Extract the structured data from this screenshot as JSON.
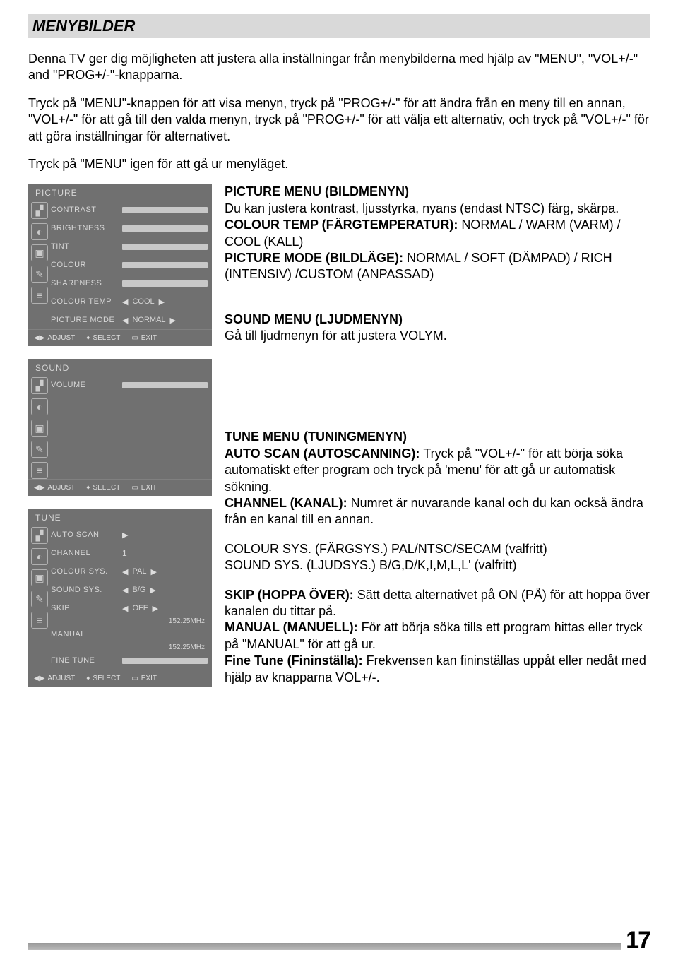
{
  "header": "MENYBILDER",
  "intro": "Denna TV ger dig möjligheten att justera alla inställningar från menybilderna med hjälp av \"MENU\", \"VOL+/-\" and \"PROG+/-\"-knapparna.",
  "para1": "Tryck på \"MENU\"-knappen för att visa menyn, tryck på \"PROG+/-\" för att ändra från en meny till en annan, \"VOL+/-\" för att gå till den valda menyn, tryck på \"PROG+/-\" för att välja ett alternativ, och tryck på \"VOL+/-\" för att göra inställningar för alternativet.",
  "para2": "Tryck på \"MENU\" igen för att gå ur menyläget.",
  "panels": {
    "picture": {
      "title": "PICTURE",
      "rows": {
        "contrast": "CONTRAST",
        "brightness": "BRIGHTNESS",
        "tint": "TINT",
        "colour": "COLOUR",
        "sharpness": "SHARPNESS",
        "colourtemp": "COLOUR TEMP",
        "colourtemp_val": "COOL",
        "picmode": "PICTURE MODE",
        "picmode_val": "NORMAL"
      }
    },
    "sound": {
      "title": "SOUND",
      "rows": {
        "volume": "VOLUME"
      }
    },
    "tune": {
      "title": "TUNE",
      "rows": {
        "autoscan": "AUTO SCAN",
        "channel": "CHANNEL",
        "channel_val": "1",
        "coloursys": "COLOUR SYS.",
        "coloursys_val": "PAL",
        "soundsys": "SOUND SYS.",
        "soundsys_val": "B/G",
        "skip": "SKIP",
        "skip_val": "OFF",
        "manual": "MANUAL",
        "finetune": "FINE TUNE",
        "freq": "152.25MHz"
      }
    },
    "footer": {
      "adjust": "ADJUST",
      "select": "SELECT",
      "exit": "EXIT"
    }
  },
  "sections": {
    "picture": {
      "h": "PICTURE MENU (BILDMENYN)",
      "t1": "Du kan justera kontrast, ljusstyrka, nyans (endast NTSC) färg, skärpa.",
      "t2a": "COLOUR TEMP (FÄRGTEMPERATUR): ",
      "t2b": "NORMAL / WARM (VARM) / COOL (KALL)",
      "t3a": "PICTURE MODE (BILDLÄGE): ",
      "t3b": "NORMAL / SOFT (DÄMPAD) / RICH (INTENSIV) /CUSTOM (ANPASSAD)"
    },
    "sound": {
      "h": "SOUND MENU (LJUDMENYN)",
      "t": "Gå till ljudmenyn för att justera VOLYM."
    },
    "tune": {
      "h": "TUNE MENU (TUNINGMENYN)",
      "t1a": "AUTO SCAN (AUTOSCANNING): ",
      "t1b": "Tryck på \"VOL+/-\" för att börja söka automatiskt efter program och tryck på 'menu' för att gå ur automatisk sökning.",
      "t2a": "CHANNEL (KANAL): ",
      "t2b": "Numret är nuvarande kanal och du kan också ändra från en kanal till en annan.",
      "t3": "COLOUR SYS. (FÄRGSYS.) PAL/NTSC/SECAM (valfritt)",
      "t4": "SOUND SYS. (LJUDSYS.) B/G,D/K,I,M,L,L' (valfritt)",
      "t5a": "SKIP (HOPPA ÖVER): ",
      "t5b": "Sätt detta alternativet på ON (PÅ) för att hoppa över kanalen du tittar på.",
      "t6a": "MANUAL (MANUELL): ",
      "t6b": "För att börja söka tills ett program hittas eller tryck på \"MANUAL\" för att gå ur.",
      "t7a": "Fine Tune (Fininställa): ",
      "t7b": "Frekvensen kan fininställas uppåt eller nedåt med hjälp av knapparna VOL+/-."
    }
  },
  "pagenum": "17"
}
